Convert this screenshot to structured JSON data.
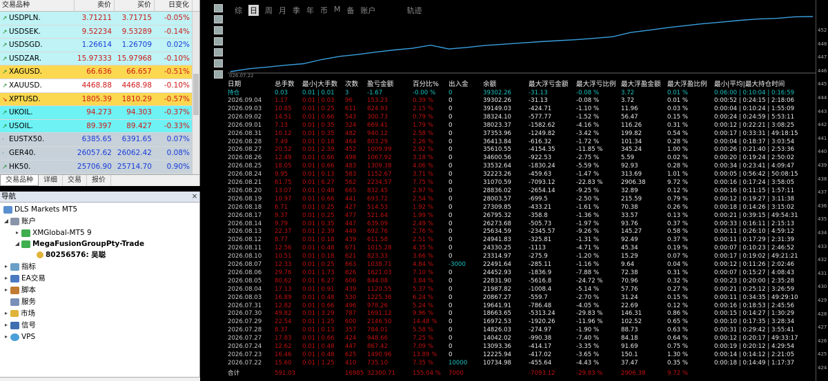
{
  "market_watch": {
    "headers": {
      "symbol": "交易品种",
      "bid": "卖价",
      "ask": "买价",
      "change": "日变化"
    },
    "rows": [
      {
        "symbol": "USDPLN.",
        "bid": "3.71211",
        "ask": "3.71715",
        "change": "-0.05%",
        "dir": "up",
        "bg": "#bff3f5"
      },
      {
        "symbol": "USDSEK.",
        "bid": "9.52234",
        "ask": "9.53289",
        "change": "-0.14%",
        "dir": "up",
        "bg": "#bff3f5"
      },
      {
        "symbol": "USDSGD.",
        "bid": "1.26614",
        "ask": "1.26709",
        "change": "0.02%",
        "dir": "up",
        "bg": "#bff3f5"
      },
      {
        "symbol": "USDZAR.",
        "bid": "15.97333",
        "ask": "15.97968",
        "change": "-0.10%",
        "dir": "up",
        "bg": "#bff3f5"
      },
      {
        "symbol": "XAGUSD.",
        "bid": "66.636",
        "ask": "66.657",
        "change": "-0.51%",
        "dir": "up",
        "bg": "#fbd850"
      },
      {
        "symbol": "XAUUSD.",
        "bid": "4468.88",
        "ask": "4468.98",
        "change": "-0.10%",
        "dir": "up",
        "bg": "#ffffff"
      },
      {
        "symbol": "XPTUSD.",
        "bid": "1805.39",
        "ask": "1810.29",
        "change": "-0.57%",
        "dir": "dn",
        "bg": "#fbd850"
      },
      {
        "symbol": "UKOIL.",
        "bid": "94.273",
        "ask": "94.303",
        "change": "-0.37%",
        "dir": "up",
        "bg": "#6ef2f4"
      },
      {
        "symbol": "USOIL.",
        "bid": "89.397",
        "ask": "89.427",
        "change": "-0.33%",
        "dir": "up",
        "bg": "#6ef2f4"
      },
      {
        "symbol": "EUSTX50.",
        "bid": "6385.65",
        "ask": "6391.65",
        "change": "0.07%",
        "dir": "none",
        "bg": "#c6d1da"
      },
      {
        "symbol": "GER40.",
        "bid": "26057.62",
        "ask": "26062.42",
        "change": "0.08%",
        "dir": "none",
        "bg": "#c6d1da"
      },
      {
        "symbol": "HK50.",
        "bid": "25706.90",
        "ask": "25714.70",
        "change": "0.90%",
        "dir": "up",
        "bg": "#c6d1da"
      },
      {
        "symbol": "JPN225.",
        "bid": "65058.22",
        "ask": "65091.22",
        "change": "0.74%",
        "dir": "up",
        "bg": "#c6d1da"
      },
      {
        "symbol": "NAS100.",
        "bid": "28501.10",
        "ask": "28503.00",
        "change": "-0.46%",
        "dir": "up",
        "bg": "#c6d1da"
      }
    ],
    "tabs": [
      "交易品种",
      "详细",
      "交易",
      "报价"
    ]
  },
  "navigator": {
    "title": "导航",
    "broker": "DLS Markets MT5",
    "accounts_label": "账户",
    "server1": "XMGlobal-MT5 9",
    "server2": "MegaFusionGroupPty-Trade",
    "account_id": "80256576: 吴聪",
    "indicators": "指标",
    "ea": "EA交易",
    "scripts": "脚本",
    "services": "服务",
    "market": "市场",
    "signals": "信号",
    "vps": "VPS"
  },
  "toolbar": {
    "timeframes": [
      "综",
      "日",
      "周",
      "月",
      "季",
      "年",
      "币",
      "M",
      "备",
      "账户"
    ],
    "active": "日",
    "track": "轨迹"
  },
  "chart": {
    "start_label": "026.07.22",
    "price_ticks": [
      "452",
      "448",
      "447",
      "446",
      "445",
      "444",
      "443",
      "442",
      "441",
      "440",
      "439",
      "438",
      "437",
      "436",
      "435",
      "434",
      "433",
      "432",
      "431",
      "430",
      "429",
      "428",
      "427",
      "426",
      "425",
      "424"
    ],
    "line_color": "#3aa0e0"
  },
  "stats": {
    "headers": [
      "日期",
      "总手数",
      "最小|大手数",
      "次数",
      "盈亏金额",
      "百分比%",
      "出入金",
      "余额",
      "最大浮亏金额",
      "最大浮亏比例",
      "最大浮盈金额",
      "最大浮盈比例",
      "最小|平均|最大持仓时间"
    ],
    "holding": [
      "持仓",
      "0.03",
      "0.01 | 0.01",
      "3",
      "-1.67",
      "-0.00 %",
      "0",
      "39302.26",
      "-31.13",
      "-0.08 %",
      "3.72",
      "0.01 %",
      "0:06:00 | 0:10:04 | 0:16:59"
    ],
    "rows": [
      [
        "2026.09.04",
        "1.17",
        "0.01 | 0.03",
        "96",
        "153.23",
        "0.39 %",
        "0",
        "39302.26",
        "-31.13",
        "-0.08 %",
        "3.72",
        "0.01 %",
        "0:00:52 | 0:24:15 | 2:18:06"
      ],
      [
        "2026.09.03",
        "10.85",
        "0.01 | 0.25",
        "611",
        "824.93",
        "2.15 %",
        "0",
        "39149.03",
        "-424.71",
        "-1.10 %",
        "11.96",
        "0.03 %",
        "0:00:04 | 0:10:24 | 1:55:09"
      ],
      [
        "2026.09.02",
        "14.51",
        "0.01 | 0.66",
        "543",
        "300.73",
        "0.79 %",
        "0",
        "38324.10",
        "-577.77",
        "-1.52 %",
        "56.47",
        "0.15 %",
        "0:00:24 | 0:24:59 | 5:53:11"
      ],
      [
        "2026.09.01",
        "7.13",
        "0.01 | 0.35",
        "324",
        "669.41",
        "1.79 %",
        "0",
        "38023.37",
        "-1582.62",
        "-4.16 %",
        "116.26",
        "0.31 %",
        "0:00:12 | 0:22:21 | 3:08:25"
      ],
      [
        "2026.08.31",
        "10.12",
        "0.01 | 0.35",
        "482",
        "940.12",
        "2.58 %",
        "0",
        "37353.96",
        "-1249.82",
        "-3.42 %",
        "199.82",
        "0.54 %",
        "0:00:17 | 0:33:31 | 49:18:15"
      ],
      [
        "2026.08.28",
        "7.49",
        "0.01 | 0.18",
        "464",
        "803.29",
        "2.26 %",
        "0",
        "36413.84",
        "-616.32",
        "-1.72 %",
        "101.34",
        "0.28 %",
        "0:00:04 | 0:18:37 | 3:03:54"
      ],
      [
        "2026.08.27",
        "20.52",
        "0.01 | 2.39",
        "452",
        "1009.99",
        "2.92 %",
        "0",
        "35610.55",
        "-4154.35",
        "-11.85 %",
        "345.24",
        "1.00 %",
        "0:00:26 | 0:21:40 | 2:53:36"
      ],
      [
        "2026.08.26",
        "12.49",
        "0.01 | 0.66",
        "498",
        "1067.92",
        "3.18 %",
        "0",
        "34600.56",
        "-922.53",
        "-2.75 %",
        "5.59",
        "0.02 %",
        "0:00:20 | 0:19:24 | 2:50:02"
      ],
      [
        "2026.08.25",
        "18.05",
        "0.01 | 0.66",
        "483",
        "1309.38",
        "4.06 %",
        "0",
        "33532.64",
        "-1830.24",
        "-5.59 %",
        "92.93",
        "0.28 %",
        "0:00:34 | 0:23:41 | 4:09:47"
      ],
      [
        "2026.08.24",
        "9.95",
        "0.01 | 0.13",
        "583",
        "1152.67",
        "3.71 %",
        "0",
        "32223.26",
        "-459.63",
        "-1.47 %",
        "313.69",
        "1.01 %",
        "0:00:05 | 0:56:42 | 50:08:15"
      ],
      [
        "2026.08.21",
        "61.75",
        "0.01 | 6.27",
        "562",
        "2234.57",
        "7.75 %",
        "0",
        "31070.59",
        "-7093.12",
        "-22.83 %",
        "2906.38",
        "9.72 %",
        "0:00:16 | 0:17:24 | 3:58:05"
      ],
      [
        "2026.08.20",
        "13.07",
        "0.01 | 0.48",
        "665",
        "832.45",
        "2.97 %",
        "0",
        "28836.02",
        "-2654.14",
        "-9.25 %",
        "32.89",
        "0.12 %",
        "0:00:16 | 0:11:15 | 1:57:11"
      ],
      [
        "2026.08.19",
        "10.97",
        "0.01 | 0.66",
        "441",
        "693.72",
        "2.54 %",
        "0",
        "28003.57",
        "-699.5",
        "-2.50 %",
        "215.59",
        "0.79 %",
        "0:00:12 | 0:19:27 | 3:11:38"
      ],
      [
        "2026.08.18",
        "6.71",
        "0.01 | 0.25",
        "427",
        "514.53",
        "1.92 %",
        "0",
        "27309.85",
        "-433.21",
        "-1.61 %",
        "70.38",
        "0.26 %",
        "0:00:18 | 0:14:26 | 3:15:02"
      ],
      [
        "2026.08.17",
        "9.37",
        "0.01 | 0.25",
        "477",
        "521.64",
        "1.99 %",
        "0",
        "26795.32",
        "-358.8",
        "-1.36 %",
        "33.57",
        "0.13 %",
        "0:00:21 | 0:39:15 | 49:54:31"
      ],
      [
        "2026.08.14",
        "9.79",
        "0.01 | 0.35",
        "447",
        "639.09",
        "2.49 %",
        "0",
        "26273.68",
        "-505.73",
        "-1.97 %",
        "93.76",
        "0.37 %",
        "0:00:33 | 0:16:11 | 2:15:13"
      ],
      [
        "2026.08.13",
        "22.37",
        "0.01 | 2.39",
        "449",
        "692.76",
        "2.76 %",
        "0",
        "25634.59",
        "-2345.57",
        "-9.26 %",
        "145.27",
        "0.58 %",
        "0:00:11 | 0:26:10 | 4:59:12"
      ],
      [
        "2026.08.12",
        "8.77",
        "0.01 | 0.18",
        "439",
        "611.58",
        "2.51 %",
        "0",
        "24941.83",
        "-325.81",
        "-1.31 %",
        "92.49",
        "0.37 %",
        "0:00:11 | 0:17:29 | 2:31:39"
      ],
      [
        "2026.08.11",
        "12.56",
        "0.01 | 0.48",
        "671",
        "1015.28",
        "4.35 %",
        "0",
        "24330.25",
        "-1113",
        "-4.71 %",
        "45.34",
        "0.19 %",
        "0:00:07 | 0:10:23 | 2:46:52"
      ],
      [
        "2026.08.10",
        "10.51",
        "0.01 | 0.18",
        "621",
        "823.33",
        "3.66 %",
        "0",
        "23314.97",
        "-275.9",
        "-1.20 %",
        "15.29",
        "0.07 %",
        "0:00:17 | 0:19:02 | 49:21:21"
      ],
      [
        "2026.08.07",
        "12.33",
        "0.01 | 0.25",
        "663",
        "1038.71",
        "4.84 %",
        "-3000",
        "22491.64",
        "-285.11",
        "-1.16 %",
        "9.64",
        "0.04 %",
        "0:00:12 | 0:11:26 | 2:02:46"
      ],
      [
        "2026.08.06",
        "29.76",
        "0.01 | 1.73",
        "826",
        "1621.03",
        "7.10 %",
        "0",
        "24452.93",
        "-1836.9",
        "-7.88 %",
        "72.38",
        "0.31 %",
        "0:00:07 | 0:15:27 | 4:08:43"
      ],
      [
        "2026.08.05",
        "80.62",
        "0.01 | 6.27",
        "606",
        "844.08",
        "3.84 %",
        "0",
        "22831.90",
        "-5616.8",
        "-24.72 %",
        "70.96",
        "0.32 %",
        "0:00:23 | 0:20:00 | 2:35:28"
      ],
      [
        "2026.08.04",
        "17.13",
        "0.01 | 0.91",
        "439",
        "1120.55",
        "5.37 %",
        "0",
        "21987.82",
        "-1008.4",
        "-5.14 %",
        "57.76",
        "0.27 %",
        "0:00:21 | 0:25:12 | 3:26:59"
      ],
      [
        "2026.08.03",
        "16.89",
        "0.01 | 0.48",
        "530",
        "1225.36",
        "6.24 %",
        "0",
        "20867.27",
        "-559.7",
        "-2.70 %",
        "31.24",
        "0.15 %",
        "0:00:11 | 0:34:35 | 49:29:10"
      ],
      [
        "2026.07.31",
        "12.82",
        "0.01 | 0.66",
        "496",
        "978.26",
        "5.24 %",
        "0",
        "19641.91",
        "-786.48",
        "-4.05 %",
        "22.69",
        "0.12 %",
        "0:00:16 | 0:18:53 | 2:45:56"
      ],
      [
        "2026.07.30",
        "49.82",
        "0.01 | 3.29",
        "787",
        "1691.12",
        "9.96 %",
        "0",
        "18663.65",
        "-5313.24",
        "-29.83 %",
        "146.31",
        "0.86 %",
        "0:00:15 | 0:14:27 | 1:30:29"
      ],
      [
        "2026.07.29",
        "22.54",
        "0.01 | 1.25",
        "600",
        "2146.50",
        "14.48 %",
        "0",
        "16972.53",
        "-1920.26",
        "-11.96 %",
        "102.52",
        "0.65 %",
        "0:00:10 | 0:17:35 | 3:28:34"
      ],
      [
        "2026.07.28",
        "8.37",
        "0.01 | 0.13",
        "357",
        "784.01",
        "5.58 %",
        "0",
        "14826.03",
        "-274.97",
        "-1.90 %",
        "88.73",
        "0.63 %",
        "0:00:31 | 0:29:42 | 3:55:41"
      ],
      [
        "2026.07.27",
        "17.83",
        "0.01 | 0.66",
        "424",
        "948.66",
        "7.25 %",
        "0",
        "14042.02",
        "-990.38",
        "-7.40 %",
        "84.18",
        "0.64 %",
        "0:00:12 | 0:20:17 | 49:33:17"
      ],
      [
        "2026.07.24",
        "12.62",
        "0.01 | 0.48",
        "447",
        "867.42",
        "7.09 %",
        "0",
        "13093.36",
        "-414.17",
        "-3.35 %",
        "91.69",
        "0.75 %",
        "0:00:19 | 0:20:12 | 4:29:54"
      ],
      [
        "2026.07.23",
        "16.46",
        "0.01 | 0.48",
        "625",
        "1490.96",
        "13.89 %",
        "0",
        "12225.94",
        "-417.02",
        "-3.65 %",
        "150.1",
        "1.30 %",
        "0:00:14 | 0:14:12 | 2:21:05"
      ],
      [
        "2026.07.22",
        "15.60",
        "0.01 | 1.25",
        "410",
        "735.10",
        "7.35 %",
        "10000",
        "10734.98",
        "-455.64",
        "-4.43 %",
        "37.47",
        "0.35 %",
        "0:00:18 | 0:14:49 | 1:17:37"
      ]
    ],
    "total": [
      "合计",
      "591.03",
      "",
      "16985",
      "32300.71",
      "155.04 %",
      "7000",
      "",
      "-7093.12",
      "-29.83 %",
      "2906.38",
      "9.72 %",
      ""
    ]
  }
}
